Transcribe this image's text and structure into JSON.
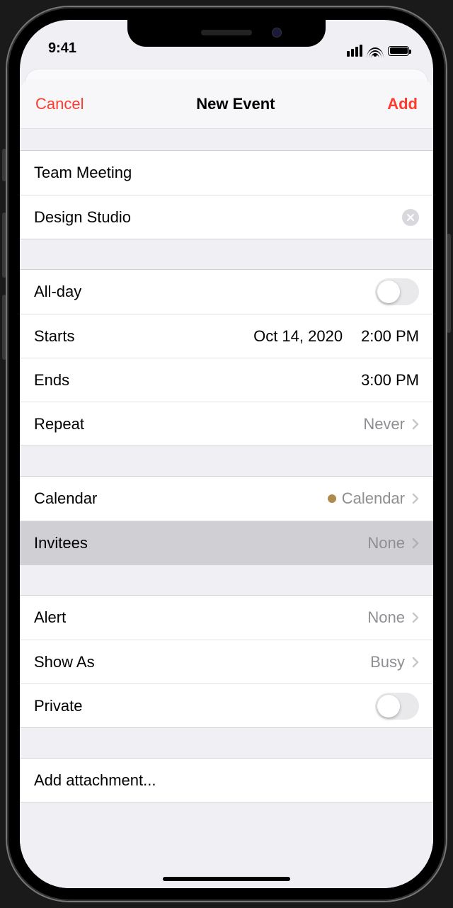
{
  "status": {
    "time": "9:41"
  },
  "nav": {
    "cancel": "Cancel",
    "title": "New Event",
    "add": "Add"
  },
  "event": {
    "title": "Team Meeting",
    "location": "Design Studio"
  },
  "time": {
    "allday_label": "All-day",
    "starts_label": "Starts",
    "starts_date": "Oct 14, 2020",
    "starts_time": "2:00 PM",
    "ends_label": "Ends",
    "ends_time": "3:00 PM",
    "repeat_label": "Repeat",
    "repeat_value": "Never"
  },
  "cal": {
    "calendar_label": "Calendar",
    "calendar_value": "Calendar",
    "invitees_label": "Invitees",
    "invitees_value": "None"
  },
  "alert": {
    "alert_label": "Alert",
    "alert_value": "None",
    "showas_label": "Show As",
    "showas_value": "Busy",
    "private_label": "Private"
  },
  "attach": {
    "label": "Add attachment..."
  }
}
